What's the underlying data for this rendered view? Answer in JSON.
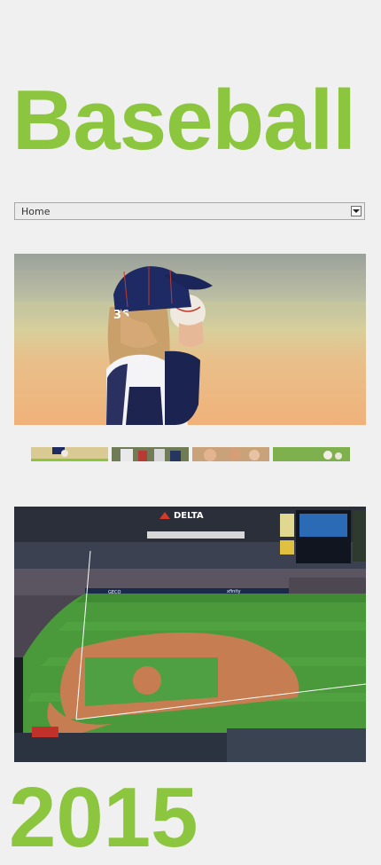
{
  "site": {
    "title": "Baseball",
    "year_heading": "2015"
  },
  "nav": {
    "selected": "Home",
    "arrow_icon": "chevron-down-icon"
  },
  "slider": {
    "thumbnail_count": 4,
    "active_index": 0
  },
  "stadium": {
    "sign_text": "DELTA",
    "board_text": "GECO",
    "ad_text": "xfinity"
  },
  "colors": {
    "accent": "#8cc63f",
    "background": "#f0f0f0"
  }
}
